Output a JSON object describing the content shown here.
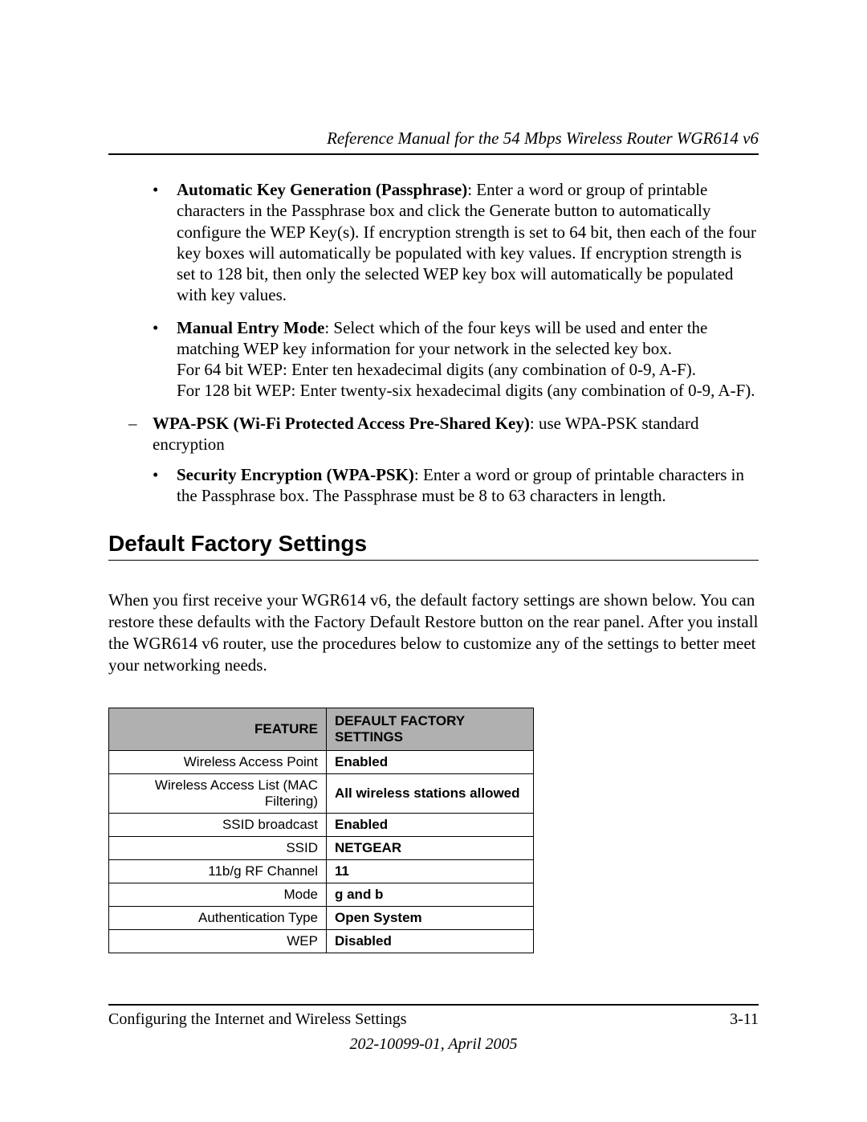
{
  "header": {
    "title": "Reference Manual for the 54 Mbps Wireless Router WGR614 v6"
  },
  "bullets": {
    "auto_key_gen": {
      "label": "Automatic Key Generation (Passphrase)",
      "text": ": Enter a word or group of printable characters in the Passphrase box and click the Generate button to automatically configure the WEP Key(s). If encryption strength is set to 64 bit, then each of the four key boxes will automatically be populated with key values. If encryption strength is set to 128 bit, then only the selected WEP key box will automatically be populated with key values."
    },
    "manual_entry": {
      "label": "Manual Entry Mode",
      "line1": ": Select which of the four keys will be used and enter the matching WEP key information for your network in the selected key box.",
      "line2": "For 64 bit WEP: Enter ten hexadecimal digits (any combination of 0-9, A-F).",
      "line3": "For 128 bit WEP: Enter twenty-six hexadecimal digits (any combination of 0-9, A-F)."
    },
    "wpa_psk": {
      "label": "WPA-PSK (Wi-Fi Protected Access Pre-Shared Key)",
      "text": ": use WPA-PSK standard encryption"
    },
    "sec_enc": {
      "label": "Security Encryption (WPA-PSK)",
      "text": ": Enter a word or group of printable characters in the Passphrase box. The Passphrase must be 8 to 63 characters in length."
    }
  },
  "section": {
    "heading": "Default Factory Settings",
    "paragraph": "When you first receive your WGR614 v6, the default factory settings are shown below. You can restore these defaults with the Factory Default Restore button on the rear panel. After you install the WGR614 v6 router, use the procedures below to customize any of the settings to better meet your networking needs."
  },
  "table": {
    "headers": {
      "feature": "FEATURE",
      "value": "DEFAULT FACTORY SETTINGS"
    },
    "rows": [
      {
        "feature": "Wireless Access Point",
        "value": "Enabled"
      },
      {
        "feature": "Wireless Access List (MAC Filtering)",
        "value": "All wireless stations allowed"
      },
      {
        "feature": "SSID broadcast",
        "value": "Enabled"
      },
      {
        "feature": "SSID",
        "value": "NETGEAR"
      },
      {
        "feature": "11b/g RF Channel",
        "value": "11"
      },
      {
        "feature": "Mode",
        "value": "g and b"
      },
      {
        "feature": "Authentication Type",
        "value": "Open System"
      },
      {
        "feature": "WEP",
        "value": "Disabled"
      }
    ]
  },
  "footer": {
    "left": "Configuring the Internet and Wireless Settings",
    "right": "3-11",
    "doc": "202-10099-01, April 2005"
  }
}
